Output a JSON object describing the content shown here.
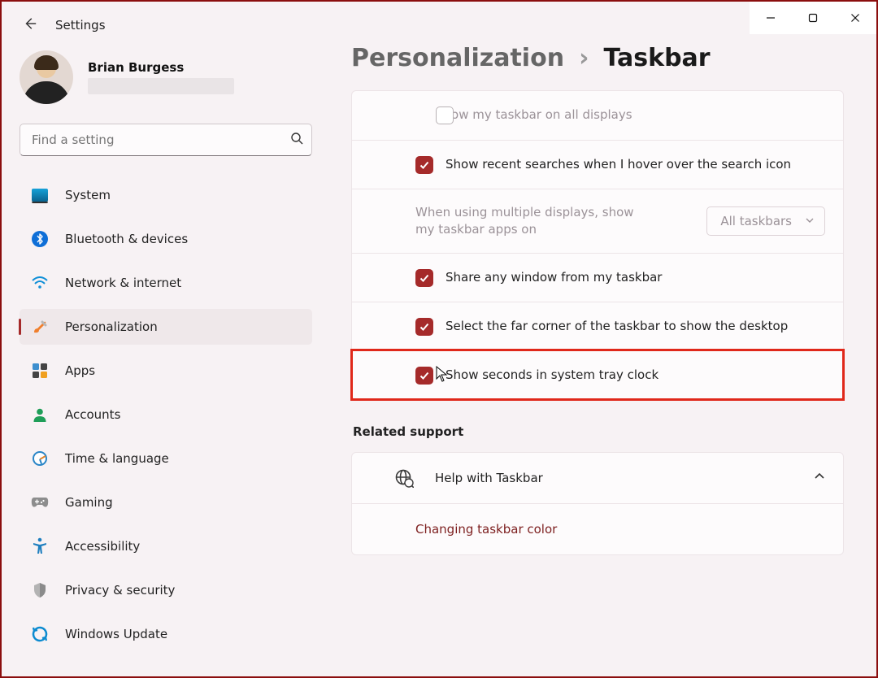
{
  "window": {
    "title": "Settings"
  },
  "user": {
    "name": "Brian Burgess"
  },
  "search": {
    "placeholder": "Find a setting"
  },
  "sidebar": {
    "items": [
      {
        "label": "System"
      },
      {
        "label": "Bluetooth & devices"
      },
      {
        "label": "Network & internet"
      },
      {
        "label": "Personalization"
      },
      {
        "label": "Apps"
      },
      {
        "label": "Accounts"
      },
      {
        "label": "Time & language"
      },
      {
        "label": "Gaming"
      },
      {
        "label": "Accessibility"
      },
      {
        "label": "Privacy & security"
      },
      {
        "label": "Windows Update"
      }
    ]
  },
  "breadcrumb": {
    "parent": "Personalization",
    "current": "Taskbar"
  },
  "settings": {
    "show_all_displays": "Show my taskbar on all displays",
    "recent_searches": "Show recent searches when I hover over the search icon",
    "multi_display_label": "When using multiple displays, show my taskbar apps on",
    "multi_display_value": "All taskbars",
    "share_window": "Share any window from my taskbar",
    "far_corner": "Select the far corner of the taskbar to show the desktop",
    "show_seconds": "Show seconds in system tray clock"
  },
  "related": {
    "title": "Related support",
    "help": "Help with Taskbar",
    "link1": "Changing taskbar color"
  }
}
